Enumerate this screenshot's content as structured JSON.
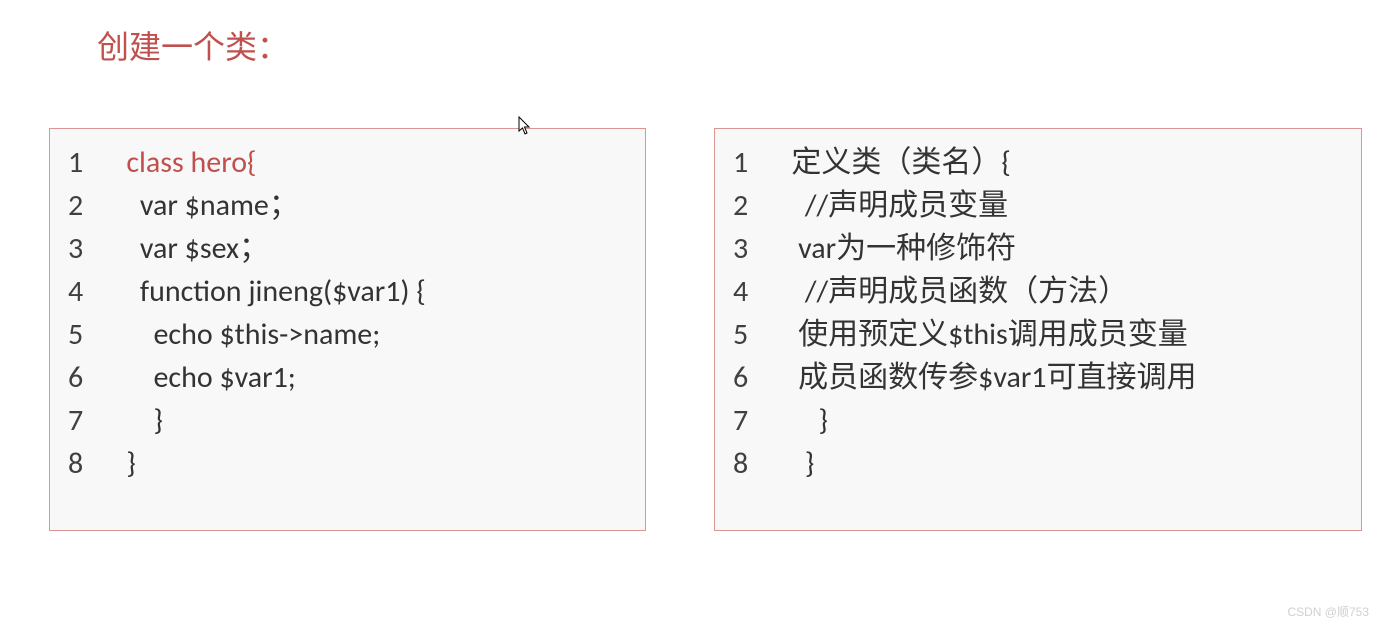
{
  "title": "创建一个类：",
  "left_box": {
    "lines": [
      {
        "num": "1",
        "text": "   class hero{",
        "highlight": true
      },
      {
        "num": "2",
        "text": "     var $name；",
        "highlight": false
      },
      {
        "num": "3",
        "text": "     var $sex；",
        "highlight": false
      },
      {
        "num": "4",
        "text": "     function jineng($var1) {",
        "highlight": false
      },
      {
        "num": "5",
        "text": "       echo $this->name;",
        "highlight": false
      },
      {
        "num": "6",
        "text": "       echo $var1;",
        "highlight": false
      },
      {
        "num": "7",
        "text": "       }",
        "highlight": false
      },
      {
        "num": "8",
        "text": "   }",
        "highlight": false
      }
    ]
  },
  "right_box": {
    "lines": [
      {
        "num": "1",
        "text": "   定义类（类名）{",
        "highlight": false
      },
      {
        "num": "2",
        "text": "     //声明成员变量",
        "highlight": false
      },
      {
        "num": "3",
        "text": "    var为一种修饰符",
        "highlight": false
      },
      {
        "num": "4",
        "text": "     //声明成员函数（方法）",
        "highlight": false
      },
      {
        "num": "5",
        "text": "    使用预定义$this调用成员变量",
        "highlight": false
      },
      {
        "num": "6",
        "text": "    成员函数传参$var1可直接调用",
        "highlight": false
      },
      {
        "num": "7",
        "text": "       }",
        "highlight": false
      },
      {
        "num": "8",
        "text": "     }",
        "highlight": false
      }
    ]
  },
  "watermark": "CSDN @顺753"
}
